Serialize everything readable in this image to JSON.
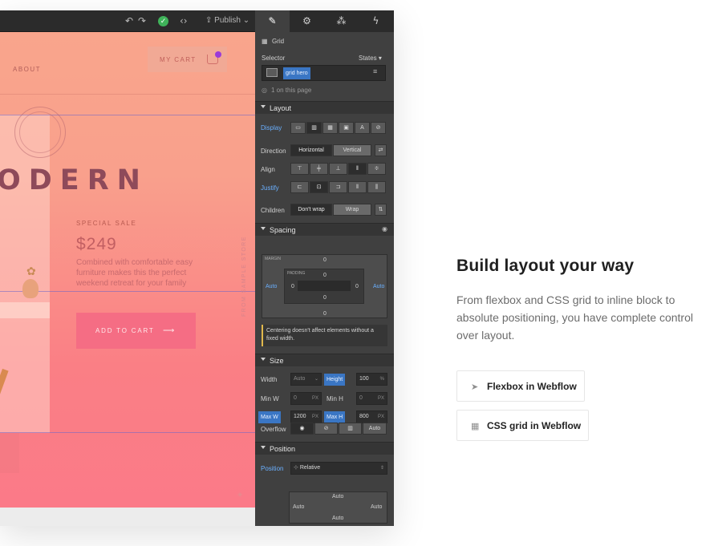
{
  "designer": {
    "topbar": {
      "undo_icon": "undo-icon",
      "redo_icon": "redo-icon",
      "status_icon": "check-circle-icon",
      "code_icon": "code-brackets-icon",
      "publish_label": "Publish"
    },
    "canvas": {
      "nav_link": "ABOUT",
      "cart_label": "MY CART",
      "hero_title": "ODERN",
      "sale_label": "SPECIAL SALE",
      "price": "$249",
      "description": "Combined with comfortable easy furniture makes this the perfect weekend retreat for your family",
      "add_to_cart": "ADD TO CART",
      "vertical_text": "FROM SAMPLE STORE"
    },
    "panel": {
      "tabs": [
        "brush-icon",
        "gear-icon",
        "interactions-icon",
        "lightning-icon"
      ],
      "element_name": "Grid",
      "selector_label": "Selector",
      "states_label": "States",
      "selector_chip": "grid hero",
      "on_page": "1 on this page",
      "layout": {
        "title": "Layout",
        "display_label": "Display",
        "direction_label": "Direction",
        "direction_options": [
          "Horizontal",
          "Vertical"
        ],
        "align_label": "Align",
        "justify_label": "Justify",
        "children_label": "Children",
        "children_options": [
          "Don't wrap",
          "Wrap"
        ]
      },
      "spacing": {
        "title": "Spacing",
        "margin_label": "MARGIN",
        "padding_label": "PADDING",
        "margin_top": "0",
        "margin_bottom": "0",
        "margin_left": "Auto",
        "margin_right": "Auto",
        "padding_top": "0",
        "padding_bottom": "0",
        "padding_left": "0",
        "padding_right": "0",
        "note": "Centering doesn't affect elements without a fixed width."
      },
      "size": {
        "title": "Size",
        "width_label": "Width",
        "width_value": "Auto",
        "height_label": "Height",
        "height_value": "100",
        "height_unit": "%",
        "min_w_label": "Min W",
        "min_w_value": "0",
        "min_h_label": "Min H",
        "min_h_value": "0",
        "max_w_label": "Max W",
        "max_w_value": "1200",
        "max_h_label": "Max H",
        "max_h_value": "800",
        "unit_px": "PX",
        "overflow_label": "Overflow",
        "overflow_auto": "Auto"
      },
      "position": {
        "title": "Position",
        "position_label": "Position",
        "position_value": "Relative",
        "auto_top": "Auto",
        "auto_left": "Auto",
        "auto_right": "Auto",
        "auto_bottom": "Auto"
      }
    }
  },
  "marketing": {
    "headline": "Build layout your way",
    "body": "From flexbox and CSS grid to inline block to absolute positioning, you have complete control over layout.",
    "links": [
      {
        "icon": "cursor-icon",
        "label": "Flexbox in Webflow"
      },
      {
        "icon": "grid-icon",
        "label": "CSS grid in Webflow"
      }
    ]
  },
  "colors": {
    "canvas_top": "#f9a58c",
    "canvas_bottom": "#fb7a88",
    "panel_bg": "#404040",
    "accent_blue": "#3a76c4"
  }
}
